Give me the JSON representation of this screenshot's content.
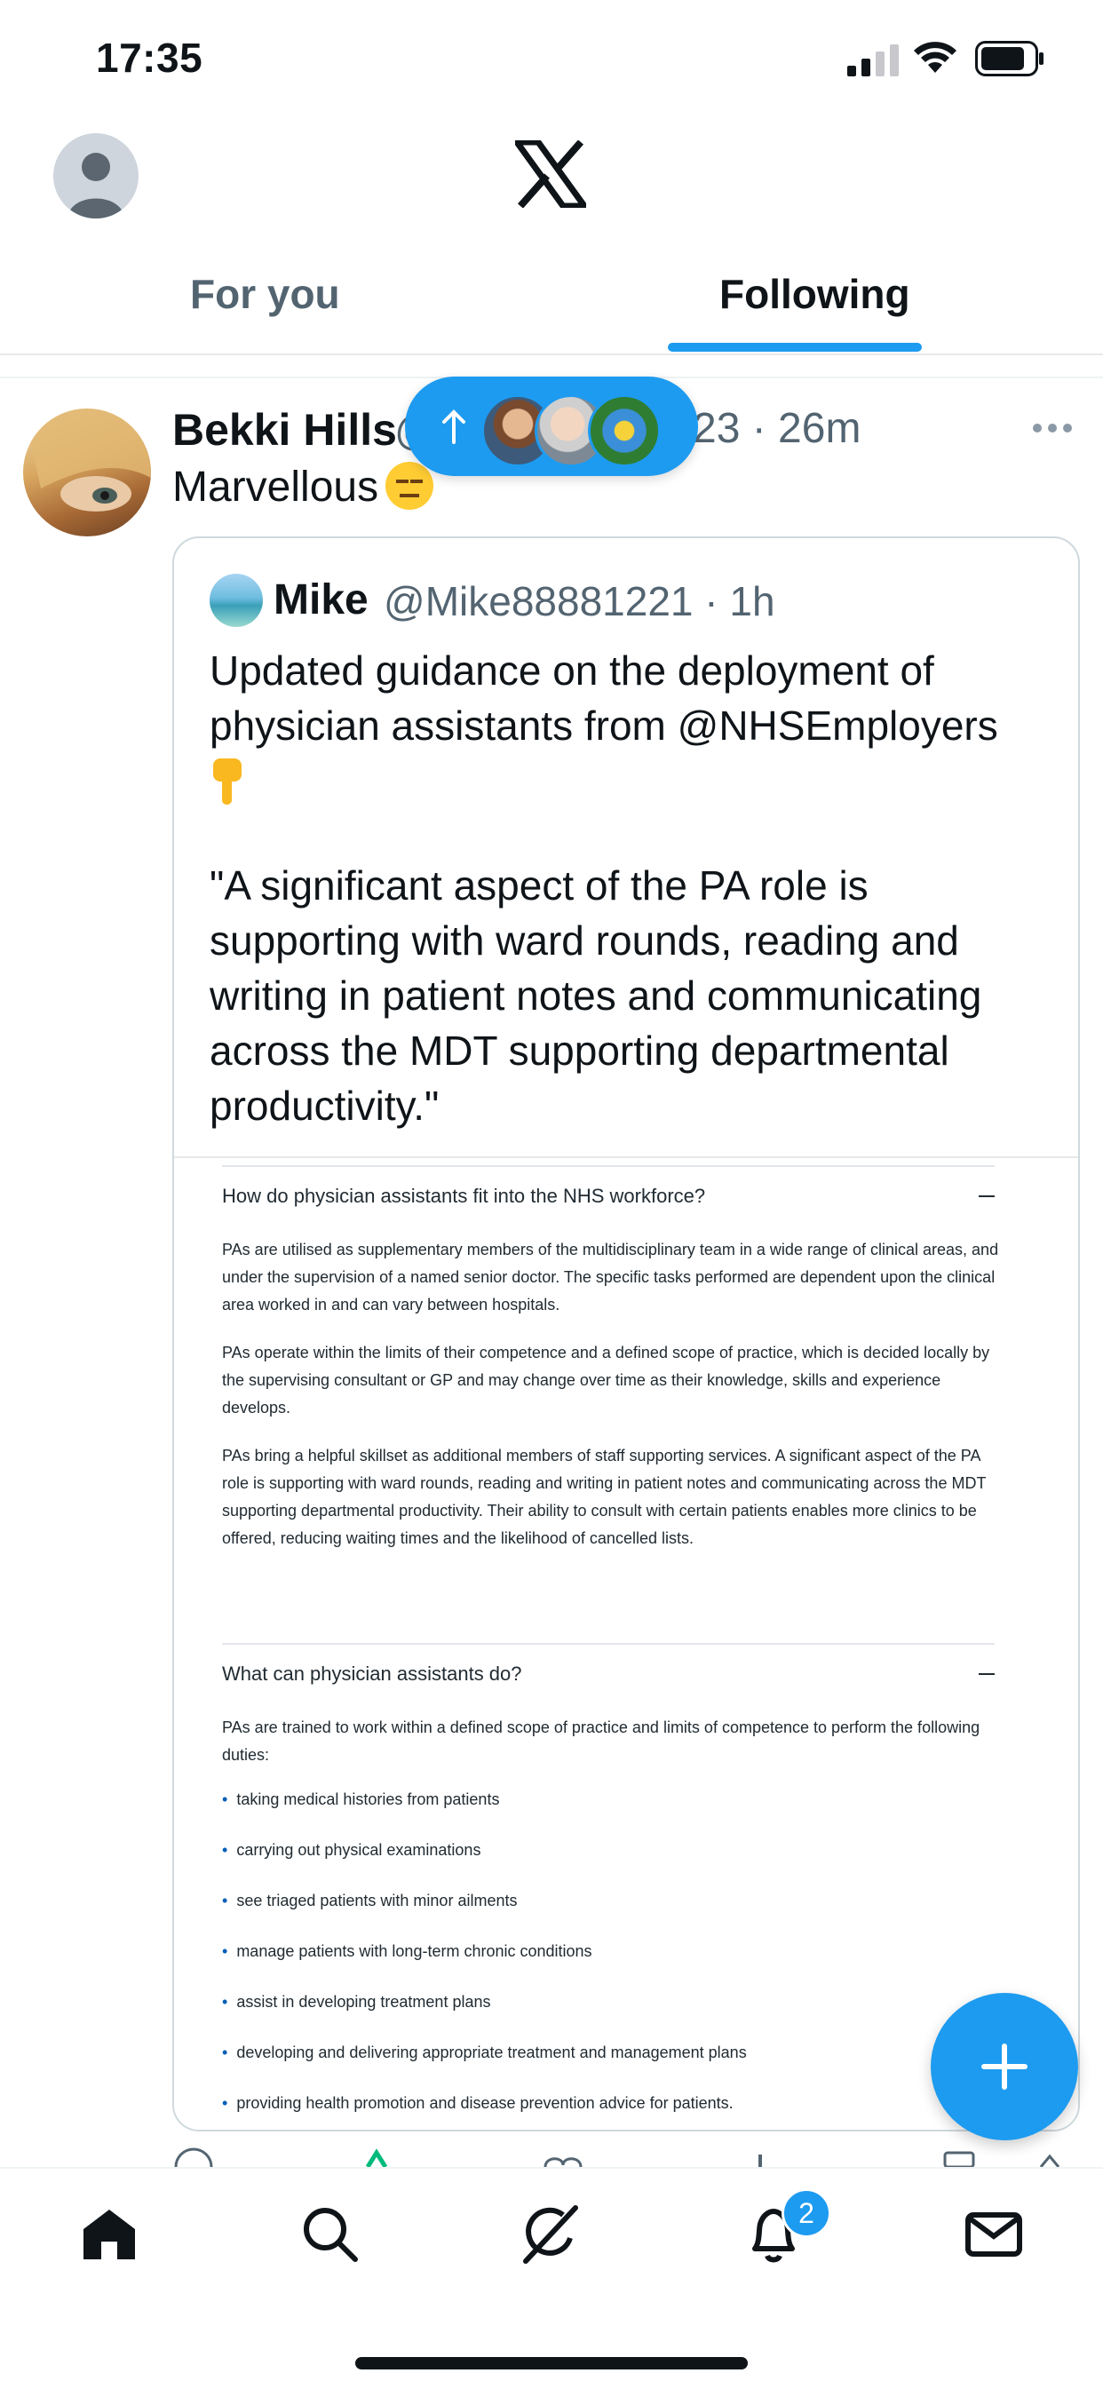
{
  "status_bar": {
    "time": "17:35"
  },
  "header": {
    "tabs": [
      "For you",
      "Following"
    ],
    "active_tab": "Following"
  },
  "tweet": {
    "author_name": "Bekki Hills",
    "handle_fragment": "@",
    "meta": "23 · 26m",
    "text": "Marvellous"
  },
  "new_posts_pill": {
    "avatars": 3
  },
  "quote": {
    "author_name": "Mike",
    "handle_time": "@Mike88881221 · 1h",
    "text_line1": "Updated guidance on the deployment of physician assistants from @NHSEmployers",
    "text_line2": "\"A significant aspect of the PA role is supporting with ward rounds, reading and writing in patient notes and communicating across the MDT supporting departmental productivity.\"",
    "image": {
      "section1_title": "How do physician assistants fit into the NHS workforce?",
      "section1_paragraphs": [
        "PAs are utilised as supplementary members of the multidisciplinary team in a wide range of clinical areas, and under the supervision of a named senior doctor. The specific tasks performed are dependent upon the clinical area worked in and can vary between hospitals.",
        "PAs operate within the limits of their competence and a defined scope of practice, which is decided locally by the supervising consultant or GP and may change over time as their knowledge, skills and experience develops.",
        "PAs bring a helpful skillset as additional members of staff supporting services. A significant aspect of the PA role is supporting with ward rounds, reading and writing in patient notes and communicating across the MDT supporting departmental productivity. Their ability to consult with certain patients enables more clinics to be offered, reducing waiting times and the likelihood of cancelled lists."
      ],
      "section2_title": "What can physician assistants do?",
      "section2_intro": "PAs are trained to work within a defined scope of practice and limits of competence to perform the following duties:",
      "bullets": [
        "taking medical histories from patients",
        "carrying out physical examinations",
        "see triaged patients with minor ailments",
        "manage patients with long-term chronic conditions",
        "assist in developing treatment plans",
        "developing and delivering appropriate treatment and management plans",
        "providing health promotion and disease prevention advice for patients."
      ]
    }
  },
  "bottom_nav": {
    "items": [
      "home-icon",
      "search-icon",
      "grok-icon",
      "notifications-icon",
      "messages-icon"
    ],
    "notification_count": "2"
  },
  "colors": {
    "accent": "#1d9bf0",
    "text": "#0f1419",
    "secondary": "#536471"
  }
}
